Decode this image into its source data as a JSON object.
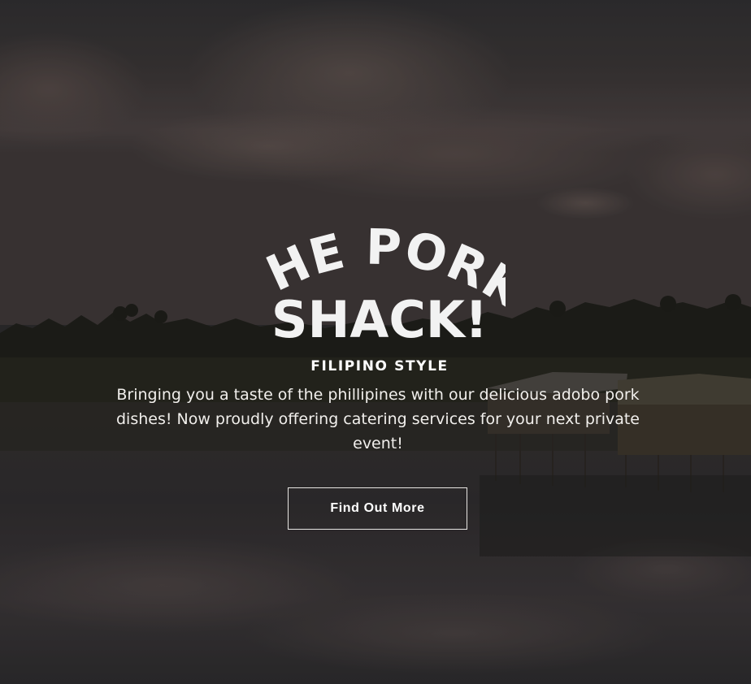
{
  "brand": {
    "logo_line_1": "THE PORK",
    "logo_line_2": "SHACK!",
    "tagline": "FILIPINO STYLE"
  },
  "hero": {
    "description": "Bringing you a taste of the phillipines with our delicious adobo pork dishes! Now proudly offering catering services for your next private event!",
    "cta_label": "Find Out More"
  },
  "colors": {
    "text": "#ffffff",
    "button_border": "#e8e6e3",
    "overlay": "#2b2a2b"
  }
}
